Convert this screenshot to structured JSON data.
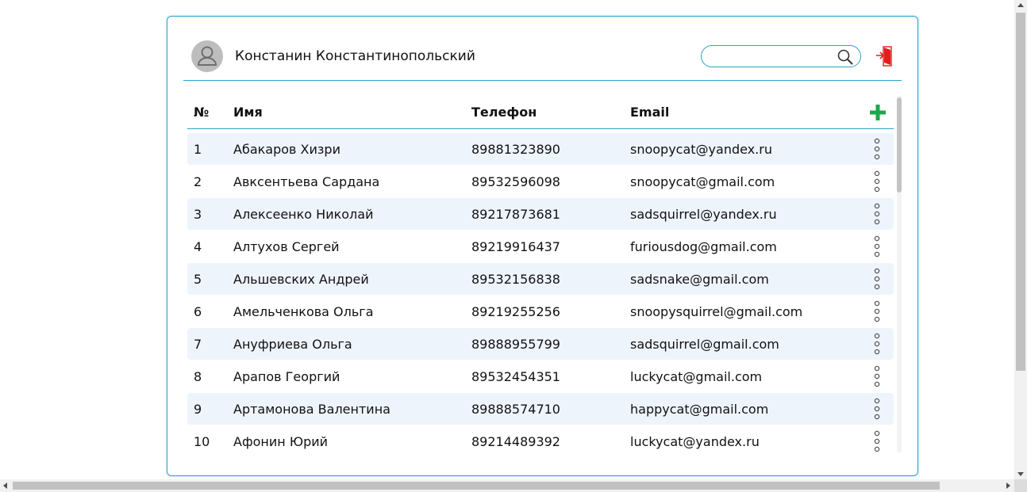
{
  "header": {
    "user_name": "Констанин Константинопольский",
    "search": {
      "value": "",
      "placeholder": ""
    }
  },
  "table": {
    "columns": {
      "num": "№",
      "name": "Имя",
      "phone": "Телефон",
      "email": "Email"
    },
    "rows": [
      {
        "num": "1",
        "name": "Абакаров Хизри",
        "phone": "89881323890",
        "email": "snoopycat@yandex.ru"
      },
      {
        "num": "2",
        "name": "Авксентьева Сардана",
        "phone": "89532596098",
        "email": "snoopycat@gmail.com"
      },
      {
        "num": "3",
        "name": "Алексеенко Николай",
        "phone": "89217873681",
        "email": "sadsquirrel@yandex.ru"
      },
      {
        "num": "4",
        "name": "Алтухов Сергей",
        "phone": "89219916437",
        "email": "furiousdog@gmail.com"
      },
      {
        "num": "5",
        "name": "Альшевских Андрей",
        "phone": "89532156838",
        "email": "sadsnake@gmail.com"
      },
      {
        "num": "6",
        "name": "Амельченкова Ольга",
        "phone": "89219255256",
        "email": "snoopysquirrel@gmail.com"
      },
      {
        "num": "7",
        "name": "Ануфриева Ольга",
        "phone": "89888955799",
        "email": "sadsquirrel@gmail.com"
      },
      {
        "num": "8",
        "name": "Арапов Георгий",
        "phone": "89532454351",
        "email": "luckycat@gmail.com"
      },
      {
        "num": "9",
        "name": "Артамонова Валентина",
        "phone": "89888574710",
        "email": "happycat@gmail.com"
      },
      {
        "num": "10",
        "name": "Афонин Юрий",
        "phone": "89214489392",
        "email": "luckycat@yandex.ru"
      }
    ]
  },
  "icons": {
    "avatar": "user-avatar-icon",
    "search": "search-icon",
    "logout": "logout-icon",
    "add": "plus-icon",
    "row_menu": "kebab-menu-icon"
  },
  "colors": {
    "accent": "#2aa4c8",
    "row_alt": "#eef4fc",
    "add": "#1aa84a",
    "logout": "#e11d1d",
    "avatar_bg": "#bdbdbd"
  }
}
